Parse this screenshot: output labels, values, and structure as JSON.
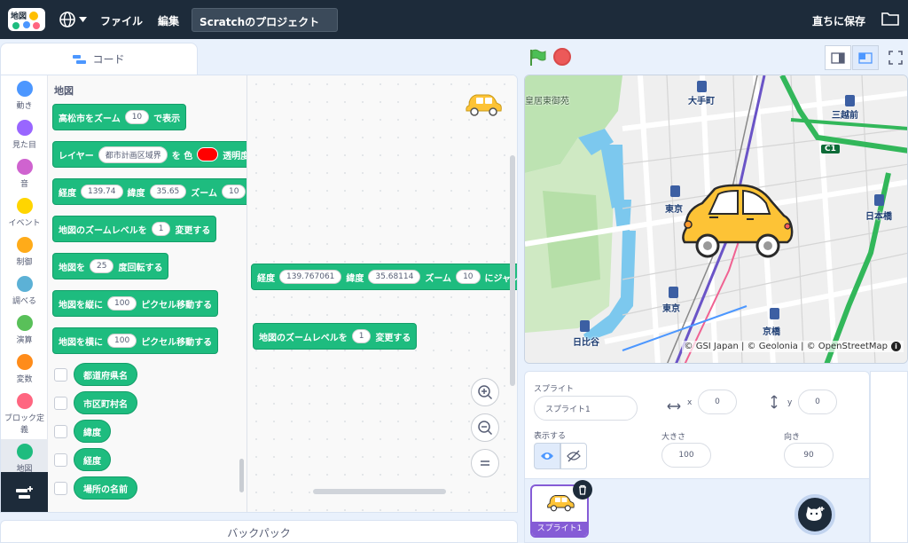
{
  "menubar": {
    "file": "ファイル",
    "edit": "編集",
    "project_title": "Scratchのプロジェクト",
    "save_now": "直ちに保存"
  },
  "tabs": {
    "code": "コード"
  },
  "categories": [
    {
      "label": "動き",
      "color": "#4c97ff"
    },
    {
      "label": "見た目",
      "color": "#9966ff"
    },
    {
      "label": "音",
      "color": "#cf63cf"
    },
    {
      "label": "イベント",
      "color": "#ffd500"
    },
    {
      "label": "制御",
      "color": "#ffab19"
    },
    {
      "label": "調べる",
      "color": "#5cb1d6"
    },
    {
      "label": "演算",
      "color": "#59c059"
    },
    {
      "label": "変数",
      "color": "#ff8c1a"
    },
    {
      "label": "ブロック定義",
      "color": "#ff6680"
    },
    {
      "label": "地図",
      "color": "#1ebc7f"
    }
  ],
  "palette": {
    "title": "地図",
    "b1": {
      "t1": "高松市をズーム",
      "v1": "10",
      "t2": "で表示"
    },
    "b2": {
      "t1": "レイヤー",
      "v1": "都市計画区域界",
      "t2": "を 色",
      "t3": "透明度"
    },
    "b3": {
      "t1": "経度",
      "v1": "139.74",
      "t2": "緯度",
      "v2": "35.65",
      "t3": "ズーム",
      "v3": "10",
      "t4": "に"
    },
    "b4": {
      "t1": "地図のズームレベルを",
      "v1": "1",
      "t2": "変更する"
    },
    "b5": {
      "t1": "地図を",
      "v1": "25",
      "t2": "度回転する"
    },
    "b6": {
      "t1": "地図を縦に",
      "v1": "100",
      "t2": "ピクセル移動する"
    },
    "b7": {
      "t1": "地図を横に",
      "v1": "100",
      "t2": "ピクセル移動する"
    },
    "r1": "都道府県名",
    "r2": "市区町村名",
    "r3": "緯度",
    "r4": "経度",
    "r5": "場所の名前"
  },
  "workspace": {
    "w1": {
      "t1": "経度",
      "v1": "139.767061",
      "t2": "緯度",
      "v2": "35.68114",
      "t3": "ズーム",
      "v3": "10",
      "t4": "にジャンプ"
    },
    "w2": {
      "t1": "地図のズームレベルを",
      "v1": "1",
      "t2": "変更する"
    }
  },
  "backpack": "バックパック",
  "map": {
    "labels": {
      "koukyo": "皇居東御苑",
      "otemachi": "大手町",
      "mitsukoshi": "三越前",
      "tokyo1": "東京",
      "tokyo2": "東京",
      "nihonbashi": "日本橋",
      "kyobashi": "京橋",
      "hibiya": "日比谷",
      "c1": "C1"
    },
    "attribution": "© GSI Japan | © Geolonia | © OpenStreetMap"
  },
  "sprite_info": {
    "sprite_label": "スプライト",
    "sprite_name": "スプライト1",
    "x_label": "x",
    "x_value": "0",
    "y_label": "y",
    "y_value": "0",
    "show_label": "表示する",
    "size_label": "大きさ",
    "size_value": "100",
    "direction_label": "向き",
    "direction_value": "90"
  },
  "sprites": [
    {
      "name": "スプライト1"
    }
  ]
}
